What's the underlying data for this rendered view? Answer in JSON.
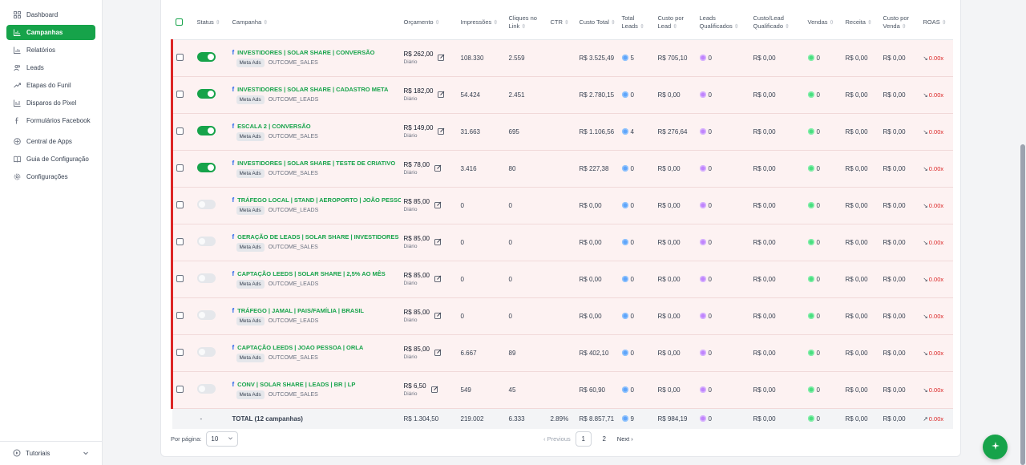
{
  "sidebar": {
    "items": [
      {
        "label": "Dashboard",
        "icon": "dashboard-icon",
        "active": false
      },
      {
        "label": "Campanhas",
        "icon": "chart-icon",
        "active": true
      },
      {
        "label": "Relatórios",
        "icon": "report-icon",
        "active": false
      },
      {
        "label": "Leads",
        "icon": "users-icon",
        "active": false
      },
      {
        "label": "Etapas do Funil",
        "icon": "trend-icon",
        "active": false
      },
      {
        "label": "Disparos do Pixel",
        "icon": "pixel-icon",
        "active": false
      },
      {
        "label": "Formulários Facebook",
        "icon": "facebook-icon",
        "active": false
      },
      {
        "label": "Central de Apps",
        "icon": "apps-icon",
        "active": false
      },
      {
        "label": "Guia de Configuração",
        "icon": "book-icon",
        "active": false
      },
      {
        "label": "Configurações",
        "icon": "gear-icon",
        "active": false
      }
    ],
    "footer_label": "Tutoriais"
  },
  "table": {
    "headers": {
      "status": "Status",
      "campanha": "Campanha",
      "orcamento": "Orçamento",
      "impressoes": "Impressões",
      "cliques": "Cliques no Link",
      "ctr": "CTR",
      "custo_total": "Custo Total",
      "total_leads": "Total Leads",
      "custo_lead": "Custo por Lead",
      "leads_qual": "Leads Qualificados",
      "custo_lead_qual": "Custo/Lead Qualificado",
      "vendas": "Vendas",
      "receita": "Receita",
      "custo_venda": "Custo por Venda",
      "roas": "ROAS"
    },
    "rows": [
      {
        "active": true,
        "name": "INVESTIDORES | SOLAR SHARE | CONVERSÃO",
        "platform": "Meta Ads",
        "objective": "OUTCOME_SALES",
        "budget": "R$ 262,00",
        "period": "Diário",
        "impressions": "108.330",
        "clicks": "2.559",
        "ctr": "",
        "cost": "R$ 3.525,49",
        "leads": "5",
        "cpl": "R$ 705,10",
        "qual": "0",
        "cpql": "R$ 0,00",
        "sales": "0",
        "revenue": "R$ 0,00",
        "cps": "R$ 0,00",
        "roas": "0.00x"
      },
      {
        "active": true,
        "name": "INVESTIDORES | SOLAR SHARE | CADASTRO META",
        "platform": "Meta Ads",
        "objective": "OUTCOME_LEADS",
        "budget": "R$ 182,00",
        "period": "Diário",
        "impressions": "54.424",
        "clicks": "2.451",
        "ctr": "",
        "cost": "R$ 2.780,15",
        "leads": "0",
        "cpl": "R$ 0,00",
        "qual": "0",
        "cpql": "R$ 0,00",
        "sales": "0",
        "revenue": "R$ 0,00",
        "cps": "R$ 0,00",
        "roas": "0.00x"
      },
      {
        "active": true,
        "name": "ESCALA 2 | CONVERSÃO",
        "platform": "Meta Ads",
        "objective": "OUTCOME_SALES",
        "budget": "R$ 149,00",
        "period": "Diário",
        "impressions": "31.663",
        "clicks": "695",
        "ctr": "",
        "cost": "R$ 1.106,56",
        "leads": "4",
        "cpl": "R$ 276,64",
        "qual": "0",
        "cpql": "R$ 0,00",
        "sales": "0",
        "revenue": "R$ 0,00",
        "cps": "R$ 0,00",
        "roas": "0.00x"
      },
      {
        "active": true,
        "name": "INVESTIDORES | SOLAR SHARE | TESTE DE CRIATIVO",
        "platform": "Meta Ads",
        "objective": "OUTCOME_SALES",
        "budget": "R$ 78,00",
        "period": "Diário",
        "impressions": "3.416",
        "clicks": "80",
        "ctr": "",
        "cost": "R$ 227,38",
        "leads": "0",
        "cpl": "R$ 0,00",
        "qual": "0",
        "cpql": "R$ 0,00",
        "sales": "0",
        "revenue": "R$ 0,00",
        "cps": "R$ 0,00",
        "roas": "0.00x"
      },
      {
        "active": false,
        "name": "TRÁFEGO LOCAL | STAND | AEROPORTO | JOÃO PESSOA",
        "platform": "Meta Ads",
        "objective": "OUTCOME_LEADS",
        "budget": "R$ 85,00",
        "period": "Diário",
        "impressions": "0",
        "clicks": "0",
        "ctr": "",
        "cost": "R$ 0,00",
        "leads": "0",
        "cpl": "R$ 0,00",
        "qual": "0",
        "cpql": "R$ 0,00",
        "sales": "0",
        "revenue": "R$ 0,00",
        "cps": "R$ 0,00",
        "roas": "0.00x"
      },
      {
        "active": false,
        "name": "GERAÇÃO DE LEADS | SOLAR SHARE | INVESTIDORES",
        "platform": "Meta Ads",
        "objective": "OUTCOME_SALES",
        "budget": "R$ 85,00",
        "period": "Diário",
        "impressions": "0",
        "clicks": "0",
        "ctr": "",
        "cost": "R$ 0,00",
        "leads": "0",
        "cpl": "R$ 0,00",
        "qual": "0",
        "cpql": "R$ 0,00",
        "sales": "0",
        "revenue": "R$ 0,00",
        "cps": "R$ 0,00",
        "roas": "0.00x"
      },
      {
        "active": false,
        "name": "CAPTAÇÃO LEEDS | SOLAR SHARE | 2,5% AO MÊS",
        "platform": "Meta Ads",
        "objective": "OUTCOME_LEADS",
        "budget": "R$ 85,00",
        "period": "Diário",
        "impressions": "0",
        "clicks": "0",
        "ctr": "",
        "cost": "R$ 0,00",
        "leads": "0",
        "cpl": "R$ 0,00",
        "qual": "0",
        "cpql": "R$ 0,00",
        "sales": "0",
        "revenue": "R$ 0,00",
        "cps": "R$ 0,00",
        "roas": "0.00x"
      },
      {
        "active": false,
        "name": "TRÁFEGO | JAMAL | PAIS/FAMÍLIA | BRASIL",
        "platform": "Meta Ads",
        "objective": "OUTCOME_LEADS",
        "budget": "R$ 85,00",
        "period": "Diário",
        "impressions": "0",
        "clicks": "0",
        "ctr": "",
        "cost": "R$ 0,00",
        "leads": "0",
        "cpl": "R$ 0,00",
        "qual": "0",
        "cpql": "R$ 0,00",
        "sales": "0",
        "revenue": "R$ 0,00",
        "cps": "R$ 0,00",
        "roas": "0.00x"
      },
      {
        "active": false,
        "name": "CAPTAÇÃO LEEDS | JOAO PESSOA | ORLA",
        "platform": "Meta Ads",
        "objective": "OUTCOME_SALES",
        "budget": "R$ 85,00",
        "period": "Diário",
        "impressions": "6.667",
        "clicks": "89",
        "ctr": "",
        "cost": "R$ 402,10",
        "leads": "0",
        "cpl": "R$ 0,00",
        "qual": "0",
        "cpql": "R$ 0,00",
        "sales": "0",
        "revenue": "R$ 0,00",
        "cps": "R$ 0,00",
        "roas": "0.00x"
      },
      {
        "active": false,
        "name": "CONV | SOLAR SHARE | LEADS | BR | LP",
        "platform": "Meta Ads",
        "objective": "OUTCOME_SALES",
        "budget": "R$ 6,50",
        "period": "Diário",
        "impressions": "549",
        "clicks": "45",
        "ctr": "",
        "cost": "R$ 60,90",
        "leads": "0",
        "cpl": "R$ 0,00",
        "qual": "0",
        "cpql": "R$ 0,00",
        "sales": "0",
        "revenue": "R$ 0,00",
        "cps": "R$ 0,00",
        "roas": "0.00x"
      }
    ],
    "total": {
      "status": "-",
      "label": "TOTAL (12 campanhas)",
      "budget": "R$ 1.304,50",
      "impressions": "219.002",
      "clicks": "6.333",
      "ctr": "2.89%",
      "cost": "R$ 8.857,71",
      "leads": "9",
      "cpl": "R$ 984,19",
      "qual": "0",
      "cpql": "R$ 0,00",
      "sales": "0",
      "revenue": "R$ 0,00",
      "cps": "R$ 0,00",
      "roas": "0.00x"
    }
  },
  "pagination": {
    "per_page_label": "Por página:",
    "per_page_value": "10",
    "prev_label": "Previous",
    "pages": [
      "1",
      "2"
    ],
    "current_page": "1",
    "next_label": "Next"
  },
  "colors": {
    "accent": "#16a34a",
    "danger": "#dc2626",
    "row_bg": "#fdf2f2"
  }
}
